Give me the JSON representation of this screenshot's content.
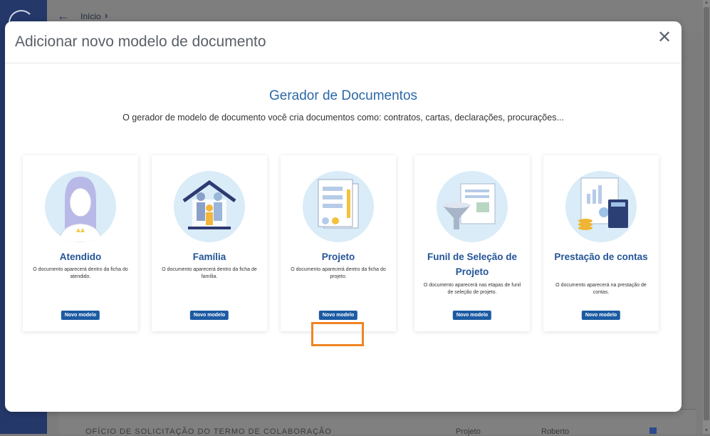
{
  "background": {
    "breadcrumb": "Início",
    "breadcrumb_sep": "›",
    "back_icon": "←",
    "row_text": "OFÍCIO DE SOLICITAÇÃO DO TERMO DE COLABORAÇÃO",
    "row_col2": "Projeto",
    "row_col3": "Roberto"
  },
  "modal": {
    "title": "Adicionar novo modelo de documento",
    "close_icon": "✕",
    "heading": "Gerador de Documentos",
    "subheading": "O gerador de modelo de documento você cria documentos como: contratos, cartas, declarações, procurações...",
    "cards": [
      {
        "title": "Atendido",
        "desc": "O documento aparecerá dentro da ficha do atendido.",
        "button": "Novo modelo",
        "icon": "person-icon"
      },
      {
        "title": "Família",
        "desc": "O documento aparecerá dentro da ficha de família.",
        "button": "Novo modelo",
        "icon": "family-icon"
      },
      {
        "title": "Projeto",
        "desc": "O documento aparecerá dentro da ficha do projeto.",
        "button": "Novo modelo",
        "icon": "project-document-icon"
      },
      {
        "title": "Funil de Seleção de Projeto",
        "desc": "O documento aparecerá nas etapas de funil de seleção de projeto.",
        "button": "Novo modelo",
        "icon": "funnel-icon"
      },
      {
        "title": "Prestação de contas",
        "desc": "O documento aparecerá na prestação de contas.",
        "button": "Novo modelo",
        "icon": "calculator-icon"
      }
    ]
  },
  "colors": {
    "accent": "#2b68a8",
    "button": "#1c5ba3",
    "highlight": "#f08424",
    "card_title": "#235497"
  }
}
